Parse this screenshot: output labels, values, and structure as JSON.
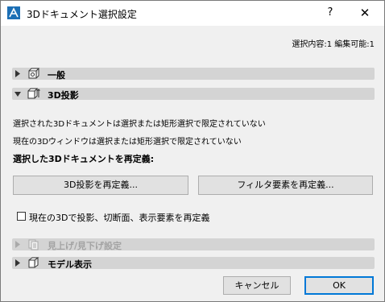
{
  "window": {
    "title": "3Dドキュメント選択設定",
    "help_label": "?",
    "close_label": "✕"
  },
  "selection_info": "選択内容:1 編集可能:1",
  "sections": {
    "general": {
      "label": "一般",
      "expanded": false
    },
    "projection": {
      "label": "3D投影",
      "expanded": true
    },
    "elevation": {
      "label": "見上げ/見下げ設定",
      "expanded": false,
      "enabled": false
    },
    "model": {
      "label": "モデル表示",
      "expanded": false
    }
  },
  "projection_panel": {
    "info_line1": "選択された3Dドキュメントは選択または矩形選択で限定されていない",
    "info_line2": "現在の3Dウィンドウは選択または矩形選択で限定されていない",
    "heading": "選択した3Dドキュメントを再定義:",
    "redefine_projection_button": "3D投影を再定義...",
    "redefine_filter_button": "フィルタ要素を再定義...",
    "checkbox_label": "現在の3Dで投影、切断面、表示要素を再定義",
    "checkbox_checked": false
  },
  "footer": {
    "cancel_label": "キャンセル",
    "ok_label": "OK"
  },
  "colors": {
    "accent": "#0078d7",
    "section_bg": "#d4d4d4",
    "window_bg": "#f0f0f0"
  }
}
